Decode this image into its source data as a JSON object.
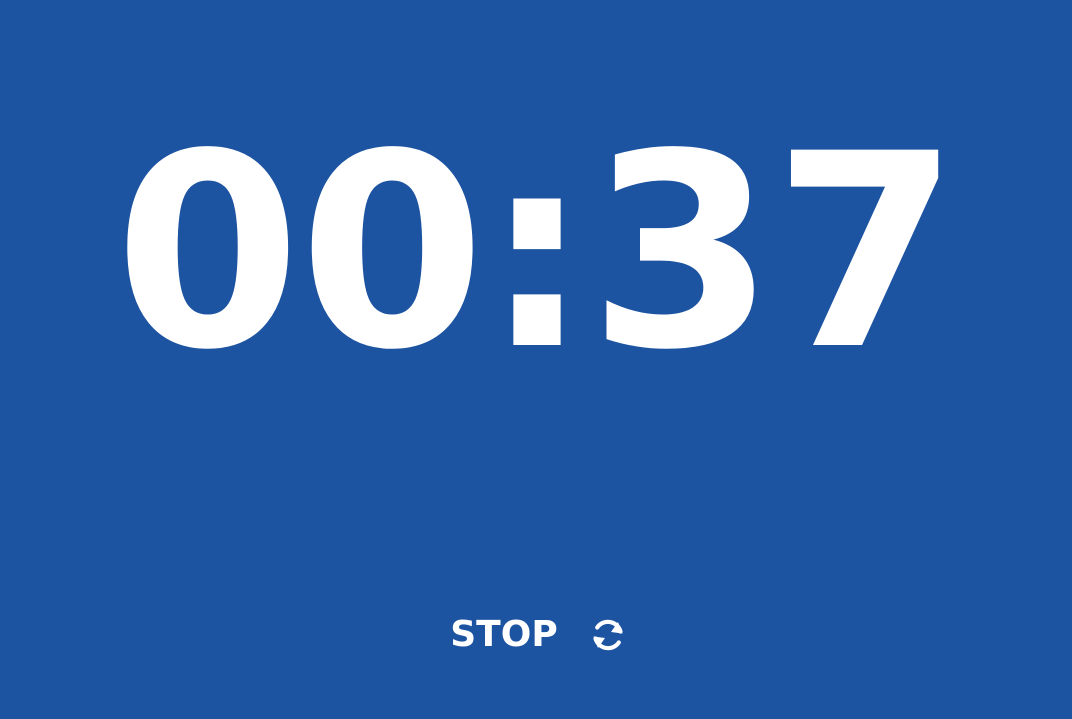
{
  "timer": {
    "display": "00:37"
  },
  "controls": {
    "stop_label": "STOP",
    "reset_icon": "refresh-icon"
  },
  "colors": {
    "background": "#1d54a2",
    "foreground": "#ffffff"
  }
}
